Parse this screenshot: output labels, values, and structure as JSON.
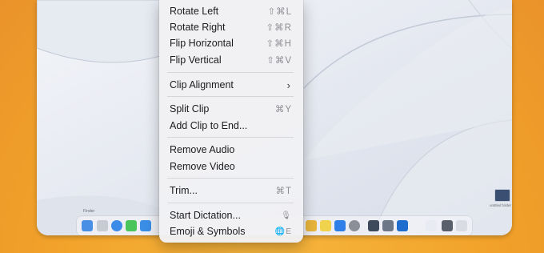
{
  "menu": {
    "items": [
      {
        "label": "Rotate Left",
        "shortcut": "⇧⌘L"
      },
      {
        "label": "Rotate Right",
        "shortcut": "⇧⌘R"
      },
      {
        "label": "Flip Horizontal",
        "shortcut": "⇧⌘H"
      },
      {
        "label": "Flip Vertical",
        "shortcut": "⇧⌘V"
      },
      {
        "label": "Clip Alignment",
        "shortcut": ""
      },
      {
        "label": "Split Clip",
        "shortcut": "⌘Y"
      },
      {
        "label": "Add Clip to End...",
        "shortcut": ""
      },
      {
        "label": "Remove Audio",
        "shortcut": ""
      },
      {
        "label": "Remove Video",
        "shortcut": ""
      },
      {
        "label": "Trim...",
        "shortcut": "⌘T"
      },
      {
        "label": "Start Dictation...",
        "shortcut": "🎙"
      },
      {
        "label": "Emoji & Symbols",
        "shortcut": "🌐E"
      }
    ],
    "submenu_icon": "chevron-right-icon"
  },
  "dock": {
    "label": "Finder",
    "desktop_icon_label": "untitled folder"
  },
  "colors": {
    "background": "#f2a32a",
    "menu_bg": "#f1f1f4",
    "text": "#1c1c1e",
    "shortcut": "#8d8d92"
  }
}
